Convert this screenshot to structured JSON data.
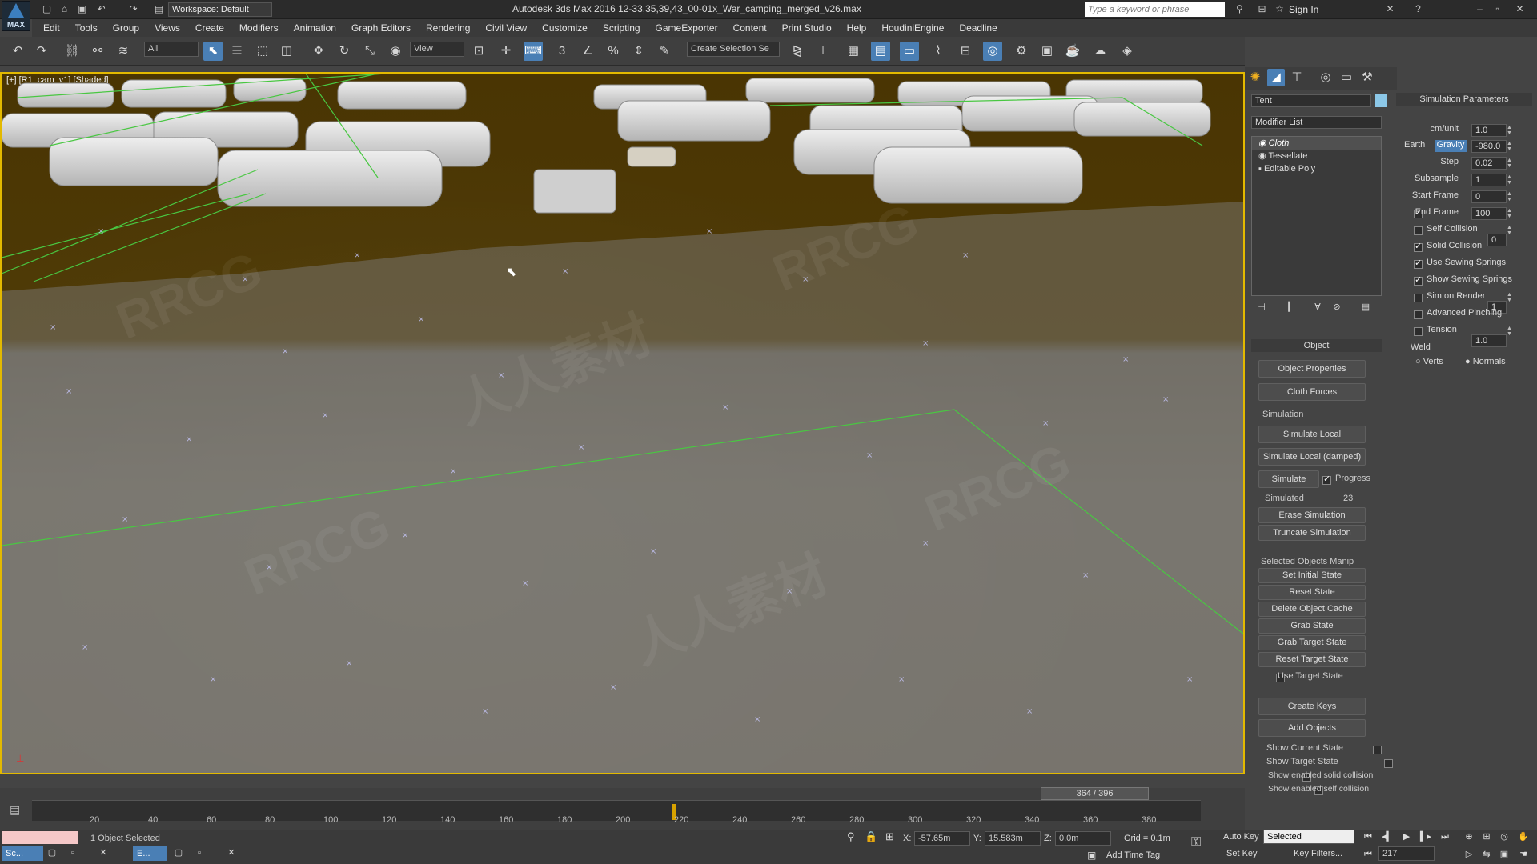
{
  "app": {
    "logo_text": "MAX"
  },
  "titlebar": {
    "workspace": "Workspace: Default",
    "title": "Autodesk 3ds Max 2016    12-33,35,39,43_00-01x_War_camping_merged_v26.max",
    "search_placeholder": "Type a keyword or phrase",
    "signin": "Sign In"
  },
  "menubar": {
    "items": [
      "Edit",
      "Tools",
      "Group",
      "Views",
      "Create",
      "Modifiers",
      "Animation",
      "Graph Editors",
      "Rendering",
      "Civil View",
      "Customize",
      "Scripting",
      "GameExporter",
      "Content",
      "Print Studio",
      "Help",
      "HoudiniEngine",
      "Deadline"
    ]
  },
  "toolbar": {
    "filter": "All",
    "refcoord": "View",
    "selection_set": "Create Selection Se",
    "snap_label": "3"
  },
  "viewport": {
    "label": "[+] [R1_cam_v1] [Shaded]"
  },
  "command_panel": {
    "object_name": "Tent",
    "modifier_list": "Modifier List",
    "stack": [
      "Cloth",
      "Tessellate",
      "Editable Poly"
    ],
    "object_rollout": "Object",
    "buttons_top": [
      "Object Properties",
      "Cloth Forces"
    ],
    "simulation_group": "Simulation",
    "sim_buttons": [
      "Simulate Local",
      "Simulate Local (damped)"
    ],
    "simulate": "Simulate",
    "progress": "Progress",
    "simulated_label": "Simulated",
    "simulated_value": "23",
    "sim_buttons2": [
      "Erase Simulation",
      "Truncate Simulation"
    ],
    "selected_group": "Selected Objects Manip",
    "selected_buttons": [
      "Set Initial State",
      "Reset State",
      "Delete Object Cache",
      "Grab State",
      "Grab Target State",
      "Reset Target State"
    ],
    "use_target_state": "Use Target State",
    "buttons_bottom": [
      "Create Keys",
      "Add Objects"
    ],
    "show_current_state": "Show Current State",
    "show_target_state": "Show Target State",
    "show_solid": "Show enabled solid collision",
    "show_self": "Show enabled self collision"
  },
  "sim_params": {
    "title": "Simulation Parameters",
    "cm_unit_label": "cm/unit",
    "cm_unit": "1.0",
    "earth": "Earth",
    "gravity_label": "Gravity",
    "gravity": "-980.0",
    "step_label": "Step",
    "step": "0.02",
    "subsample_label": "Subsample",
    "subsample": "1",
    "start_frame_label": "Start Frame",
    "start_frame": "0",
    "end_frame_label": "End Frame",
    "end_frame": "100",
    "self_collision_label": "Self Collision",
    "self_collision": "0",
    "solid_collision": "Solid Collision",
    "use_sewing": "Use Sewing Springs",
    "show_sewing": "Show Sewing Springs",
    "sim_on_render": "Sim on Render",
    "sim_on_render_val": "1",
    "advanced_pinching": "Advanced Pinching",
    "tension_label": "Tension",
    "tension": "1.0",
    "weld": "Weld",
    "verts": "Verts",
    "normals": "Normals"
  },
  "timeline": {
    "slider": "364 / 396",
    "progress": 0.919,
    "ticks": [
      "20",
      "40",
      "60",
      "80",
      "100",
      "120",
      "140",
      "160",
      "180",
      "200",
      "220",
      "240",
      "260",
      "280",
      "300",
      "320",
      "340",
      "360",
      "380"
    ]
  },
  "status": {
    "script_tab": "Sc...",
    "editor_tab": "E...",
    "selection": "1 Object Selected",
    "x_label": "X:",
    "x": "-57.65m",
    "y_label": "Y:",
    "y": "15.583m",
    "z_label": "Z:",
    "z": "0.0m",
    "grid": "Grid = 0.1m",
    "add_time_tag": "Add Time Tag",
    "auto_key": "Auto Key",
    "set_key": "Set Key",
    "selected": "Selected",
    "key_filters": "Key Filters...",
    "frame": "217"
  },
  "colors": {
    "accent": "#4a7fb5",
    "viewport_border": "#e3b900",
    "dirt": "#4e3a06",
    "selection_wire": "#49c742"
  },
  "watermarks": [
    "RRCG",
    "人人素材"
  ]
}
